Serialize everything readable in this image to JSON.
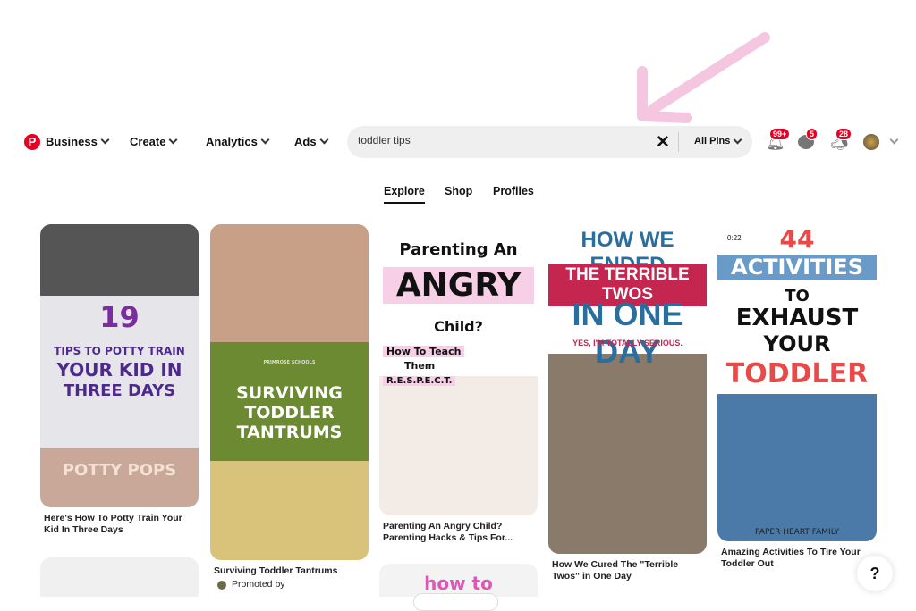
{
  "nav": {
    "items": [
      {
        "label": "Business"
      },
      {
        "label": "Create"
      },
      {
        "label": "Analytics"
      },
      {
        "label": "Ads"
      }
    ]
  },
  "search": {
    "value": "toddler tips",
    "filter": "All Pins"
  },
  "badges": {
    "notifications": "99+",
    "messages": "5",
    "updates": "28"
  },
  "tabs": [
    {
      "label": "Explore",
      "active": true
    },
    {
      "label": "Shop"
    },
    {
      "label": "Profiles"
    }
  ],
  "pins": [
    {
      "overlay": [
        "19",
        "TIPS TO POTTY TRAIN",
        "YOUR KID IN",
        "THREE DAYS",
        "POTTY POPS"
      ],
      "caption": "Here's How To Potty Train Your Kid In Three Days"
    },
    {
      "overlay": [
        "PRIMROSE SCHOOLS",
        "SURVIVING",
        "TODDLER",
        "TANTRUMS"
      ],
      "caption": "Surviving Toddler Tantrums",
      "promoted": "Promoted by"
    },
    {
      "overlay": [
        "Parenting An",
        "ANGRY",
        "Child?",
        "How To Teach",
        "Them",
        "R.E.S.P.E.C.T."
      ],
      "caption": "Parenting An Angry Child? Parenting Hacks & Tips For...",
      "next_overlay": "how to"
    },
    {
      "overlay": [
        "HOW WE ENDED",
        "THE TERRIBLE TWOS",
        "IN ONE DAY",
        "YES, I'M TOTALLY SERIOUS."
      ],
      "caption": "How We Cured The \"Terrible Twos\" in One Day"
    },
    {
      "overlay": [
        "0:22",
        "44",
        "ACTIVITIES",
        "TO",
        "EXHAUST",
        "YOUR",
        "TODDLER",
        "PAPER HEART FAMILY"
      ],
      "caption": "Amazing Activities To Tire Your Toddler Out"
    }
  ],
  "help": "?",
  "colors": {
    "brand": "#e60023",
    "arrow": "#f4c6df"
  }
}
